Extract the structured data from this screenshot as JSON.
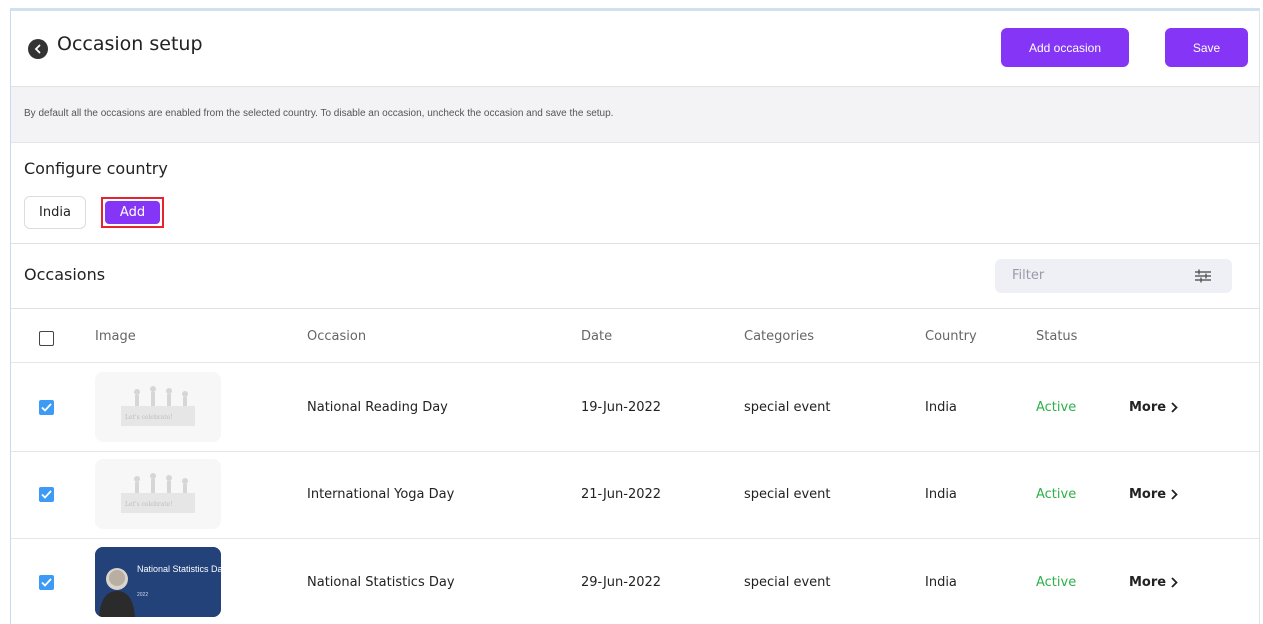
{
  "header": {
    "title": "Occasion setup",
    "add_occasion_label": "Add occasion",
    "save_label": "Save"
  },
  "info": {
    "text": "By default all the occasions are enabled from the selected country. To disable an occasion, uncheck the occasion and save the setup."
  },
  "configure": {
    "title": "Configure country",
    "country": "India",
    "add_label": "Add"
  },
  "occasions": {
    "title": "Occasions",
    "filter_placeholder": "Filter",
    "columns": [
      "Image",
      "Occasion",
      "Date",
      "Categories",
      "Country",
      "Status"
    ],
    "rows": [
      {
        "image_text": "Let's celebrate!",
        "occasion": "National Reading Day",
        "date": "19-Jun-2022",
        "category": "special event",
        "country": "India",
        "status": "Active",
        "more": "More",
        "checked": true
      },
      {
        "image_text": "Let's celebrate!",
        "occasion": "International Yoga Day",
        "date": "21-Jun-2022",
        "category": "special event",
        "country": "India",
        "status": "Active",
        "more": "More",
        "checked": true
      },
      {
        "image_text": "National Statistics Day",
        "image_sub": "2022",
        "occasion": "National Statistics Day",
        "date": "29-Jun-2022",
        "category": "special event",
        "country": "India",
        "status": "Active",
        "more": "More",
        "checked": true
      }
    ]
  },
  "colors": {
    "accent": "#8435f5",
    "status_active": "#2db14a",
    "checkbox": "#3d9bf5",
    "highlight_border": "#e5242f"
  },
  "icons": [
    "back-arrow-icon",
    "filter-sliders-icon",
    "chevron-right-icon",
    "checkmark-icon"
  ]
}
